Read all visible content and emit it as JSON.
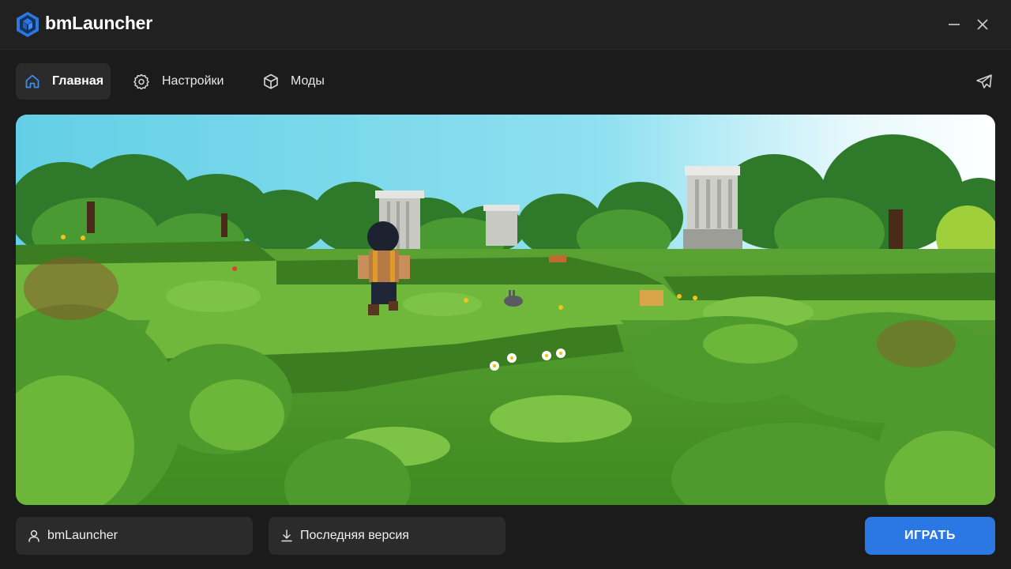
{
  "app": {
    "title": "bmLauncher",
    "logo_icon": "cube-logo-icon",
    "accent": "#2b78e4"
  },
  "window_controls": {
    "minimize_icon": "minimize-icon",
    "close_icon": "close-icon"
  },
  "nav": {
    "items": [
      {
        "label": "Главная",
        "icon": "home-icon",
        "active": true
      },
      {
        "label": "Настройки",
        "icon": "gear-icon",
        "active": false
      },
      {
        "label": "Моды",
        "icon": "cube-icon",
        "active": false
      }
    ],
    "telegram_icon": "telegram-icon"
  },
  "banner": {
    "image": "voxel-landscape-screenshot"
  },
  "bottom": {
    "username": "bmLauncher",
    "username_icon": "user-icon",
    "version": "Последняя версия",
    "version_icon": "download-icon",
    "play_label": "ИГРАТЬ"
  }
}
